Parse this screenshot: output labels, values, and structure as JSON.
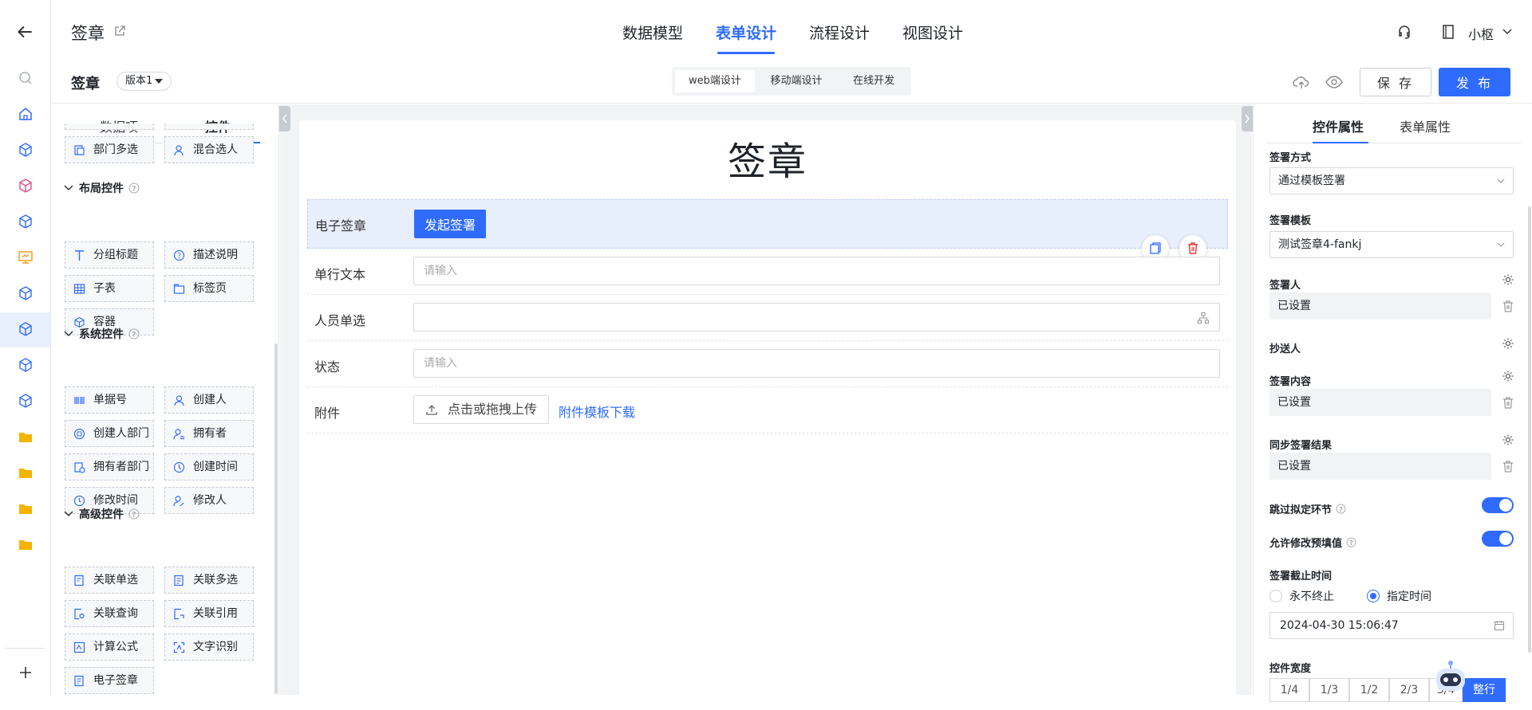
{
  "header": {
    "page_name": "签章",
    "nav_tabs": [
      "数据模型",
      "表单设计",
      "流程设计",
      "视图设计"
    ],
    "user_name": "小枢"
  },
  "subbar": {
    "title": "签章",
    "version": "版本1",
    "device_tabs": [
      "web端设计",
      "移动端设计",
      "在线开发"
    ],
    "save_label": "保 存",
    "publish_label": "发 布"
  },
  "left_panel": {
    "tabs": [
      "数据项",
      "控件"
    ],
    "top_items": [
      "部门多选",
      "混合选人"
    ],
    "categories": [
      {
        "title": "布局控件",
        "items": [
          "分组标题",
          "描述说明",
          "子表",
          "标签页",
          "容器"
        ]
      },
      {
        "title": "系统控件",
        "items": [
          "单据号",
          "创建人",
          "创建人部门",
          "拥有者",
          "拥有者部门",
          "创建时间",
          "修改时间",
          "修改人"
        ]
      },
      {
        "title": "高级控件",
        "items": [
          "关联单选",
          "关联多选",
          "关联查询",
          "关联引用",
          "计算公式",
          "文字识别",
          "电子签章"
        ]
      }
    ]
  },
  "form": {
    "title": "签章",
    "rows": [
      {
        "label": "电子签章",
        "button": "发起签署"
      },
      {
        "label": "单行文本",
        "placeholder": "请输入"
      },
      {
        "label": "人员单选",
        "placeholder": ""
      },
      {
        "label": "状态",
        "placeholder": "请输入"
      },
      {
        "label": "附件",
        "upload": "点击或拖拽上传",
        "link": "附件模板下载"
      }
    ]
  },
  "right_panel": {
    "tabs": [
      "控件属性",
      "表单属性"
    ],
    "sign_method_label": "签署方式",
    "sign_method_value": "通过模板签署",
    "template_label": "签署模板",
    "template_value": "测试签章4-fankj",
    "signer_label": "签署人",
    "signer_value": "已设置",
    "cc_label": "抄送人",
    "content_label": "签署内容",
    "content_value": "已设置",
    "sync_label": "同步签署结果",
    "sync_value": "已设置",
    "skip_label": "跳过拟定环节",
    "skip_on": true,
    "allow_label": "允许修改预填值",
    "allow_on": true,
    "deadline_label": "签署截止时间",
    "deadline_options": [
      "永不终止",
      "指定时间"
    ],
    "deadline_selected": "指定时间",
    "deadline_value": "2024-04-30 15:06:47",
    "width_label": "控件宽度",
    "width_options": [
      "1/4",
      "1/3",
      "1/2",
      "2/3",
      "3/4",
      "整行"
    ],
    "width_selected": "整行"
  },
  "colors": {
    "accent": "#2f6bff",
    "selected_row": "#e7effc"
  }
}
